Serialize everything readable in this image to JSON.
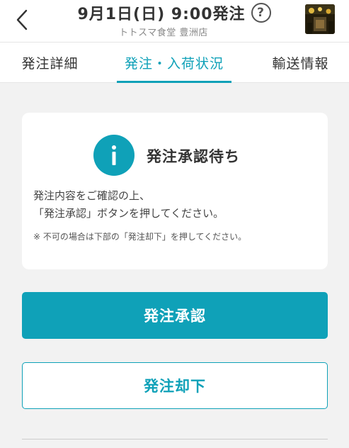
{
  "header": {
    "title": "9月1日(日) 9:00発注",
    "help_symbol": "?",
    "store_name": "トトスマ食堂 豊洲店"
  },
  "tabs": [
    {
      "label": "発注詳細",
      "active": false
    },
    {
      "label": "発注・入荷状況",
      "active": true
    },
    {
      "label": "輸送情報",
      "active": false
    }
  ],
  "status_card": {
    "title": "発注承認待ち",
    "line1": "発注内容をご確認の上、",
    "line2": "「発注承認」ボタンを押してください。",
    "note": "※ 不可の場合は下部の「発注却下」を押してください。"
  },
  "actions": {
    "approve_label": "発注承認",
    "reject_label": "発注却下"
  },
  "colors": {
    "accent": "#0fa1b8",
    "background": "#f2f2f2"
  },
  "icons": {
    "back": "chevron-left-icon",
    "help": "question-circle-icon",
    "info": "info-icon"
  }
}
